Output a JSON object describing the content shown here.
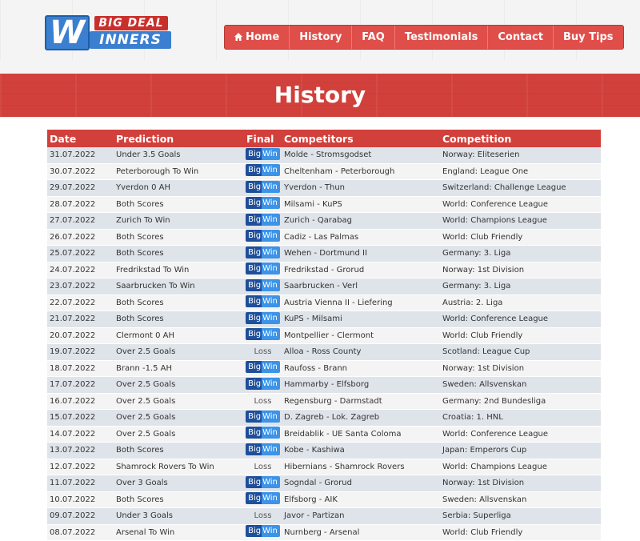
{
  "logo": {
    "w": "W",
    "top": "BIG DEAL",
    "bottom": "INNERS"
  },
  "nav": {
    "items": [
      "Home",
      "History",
      "FAQ",
      "Testimonials",
      "Contact",
      "Buy Tips"
    ]
  },
  "page_title": "History",
  "table": {
    "headers": [
      "Date",
      "Prediction",
      "Final",
      "Competitors",
      "Competition"
    ],
    "bigwin_big": "Big",
    "bigwin_win": "Win",
    "rows": [
      {
        "date": "31.07.2022",
        "prediction": "Under 3.5 Goals",
        "final": "BigWin",
        "competitors": "Molde - Stromsgodset",
        "competition": "Norway: Eliteserien"
      },
      {
        "date": "30.07.2022",
        "prediction": "Peterborough To Win",
        "final": "BigWin",
        "competitors": "Cheltenham - Peterborough",
        "competition": "England: League One"
      },
      {
        "date": "29.07.2022",
        "prediction": "Yverdon 0 AH",
        "final": "BigWin",
        "competitors": "Yverdon - Thun",
        "competition": "Switzerland: Challenge League"
      },
      {
        "date": "28.07.2022",
        "prediction": "Both Scores",
        "final": "BigWin",
        "competitors": "Milsami - KuPS",
        "competition": "World: Conference League"
      },
      {
        "date": "27.07.2022",
        "prediction": "Zurich To Win",
        "final": "BigWin",
        "competitors": "Zurich - Qarabag",
        "competition": "World: Champions League"
      },
      {
        "date": "26.07.2022",
        "prediction": "Both Scores",
        "final": "BigWin",
        "competitors": "Cadiz - Las Palmas",
        "competition": "World: Club Friendly"
      },
      {
        "date": "25.07.2022",
        "prediction": "Both Scores",
        "final": "BigWin",
        "competitors": "Wehen - Dortmund II",
        "competition": "Germany: 3. Liga"
      },
      {
        "date": "24.07.2022",
        "prediction": "Fredrikstad To Win",
        "final": "BigWin",
        "competitors": "Fredrikstad - Grorud",
        "competition": "Norway: 1st Division"
      },
      {
        "date": "23.07.2022",
        "prediction": "Saarbrucken To Win",
        "final": "BigWin",
        "competitors": "Saarbrucken - Verl",
        "competition": "Germany: 3. Liga"
      },
      {
        "date": "22.07.2022",
        "prediction": "Both Scores",
        "final": "BigWin",
        "competitors": "Austria Vienna II - Liefering",
        "competition": "Austria: 2. Liga"
      },
      {
        "date": "21.07.2022",
        "prediction": "Both Scores",
        "final": "BigWin",
        "competitors": "KuPS - Milsami",
        "competition": "World: Conference League"
      },
      {
        "date": "20.07.2022",
        "prediction": "Clermont 0 AH",
        "final": "BigWin",
        "competitors": "Montpellier - Clermont",
        "competition": "World: Club Friendly"
      },
      {
        "date": "19.07.2022",
        "prediction": "Over 2.5 Goals",
        "final": "Loss",
        "competitors": "Alloa - Ross County",
        "competition": "Scotland: League Cup"
      },
      {
        "date": "18.07.2022",
        "prediction": "Brann -1.5 AH",
        "final": "BigWin",
        "competitors": "Raufoss - Brann",
        "competition": "Norway: 1st Division"
      },
      {
        "date": "17.07.2022",
        "prediction": "Over 2.5 Goals",
        "final": "BigWin",
        "competitors": "Hammarby - Elfsborg",
        "competition": "Sweden: Allsvenskan"
      },
      {
        "date": "16.07.2022",
        "prediction": "Over 2.5 Goals",
        "final": "Loss",
        "competitors": "Regensburg - Darmstadt",
        "competition": "Germany: 2nd Bundesliga"
      },
      {
        "date": "15.07.2022",
        "prediction": "Over 2.5 Goals",
        "final": "BigWin",
        "competitors": "D. Zagreb - Lok. Zagreb",
        "competition": "Croatia: 1. HNL"
      },
      {
        "date": "14.07.2022",
        "prediction": "Over 2.5 Goals",
        "final": "BigWin",
        "competitors": "Breidablik - UE Santa Coloma",
        "competition": "World: Conference League"
      },
      {
        "date": "13.07.2022",
        "prediction": "Both Scores",
        "final": "BigWin",
        "competitors": "Kobe - Kashiwa",
        "competition": "Japan: Emperors Cup"
      },
      {
        "date": "12.07.2022",
        "prediction": "Shamrock Rovers To Win",
        "final": "Loss",
        "competitors": "Hibernians - Shamrock Rovers",
        "competition": "World: Champions League"
      },
      {
        "date": "11.07.2022",
        "prediction": "Over 3 Goals",
        "final": "BigWin",
        "competitors": "Sogndal - Grorud",
        "competition": "Norway: 1st Division"
      },
      {
        "date": "10.07.2022",
        "prediction": "Both Scores",
        "final": "BigWin",
        "competitors": "Elfsborg - AIK",
        "competition": "Sweden: Allsvenskan"
      },
      {
        "date": "09.07.2022",
        "prediction": "Under 3 Goals",
        "final": "Loss",
        "competitors": "Javor - Partizan",
        "competition": "Serbia: Superliga"
      },
      {
        "date": "08.07.2022",
        "prediction": "Arsenal To Win",
        "final": "BigWin",
        "competitors": "Nurnberg - Arsenal",
        "competition": "World: Club Friendly"
      }
    ]
  },
  "colors": {
    "accent": "#d1403b",
    "nav": "#e04e4a",
    "bigwin_dark": "#1f4f9a",
    "bigwin_light": "#3c93e8"
  }
}
